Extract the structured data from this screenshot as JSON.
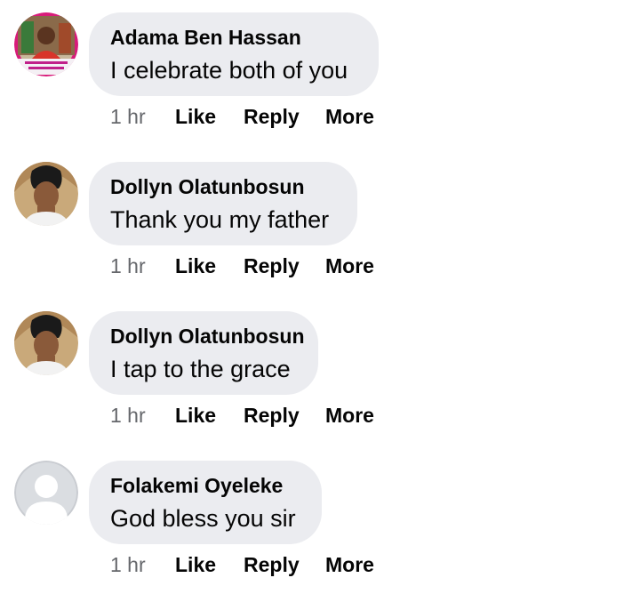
{
  "comments": [
    {
      "author": "Adama Ben Hassan",
      "text": "I celebrate both of you",
      "time": "1 hr",
      "like": "Like",
      "reply": "Reply",
      "more": "More",
      "avatar": "profile-photo-man-in-red"
    },
    {
      "author": "Dollyn Olatunbosun",
      "text": "Thank you my father",
      "time": "1 hr",
      "like": "Like",
      "reply": "Reply",
      "more": "More",
      "avatar": "profile-photo-woman"
    },
    {
      "author": "Dollyn Olatunbosun",
      "text": "I tap to the grace",
      "time": "1 hr",
      "like": "Like",
      "reply": "Reply",
      "more": "More",
      "avatar": "profile-photo-woman"
    },
    {
      "author": "Folakemi Oyeleke",
      "text": "God bless you sir",
      "time": "1 hr",
      "like": "Like",
      "reply": "Reply",
      "more": "More",
      "avatar": "default-avatar-placeholder"
    }
  ],
  "colors": {
    "bubble": "#ebecf0",
    "text": "#050505",
    "meta": "#65676b",
    "avatar_ring": "#e4007a"
  }
}
